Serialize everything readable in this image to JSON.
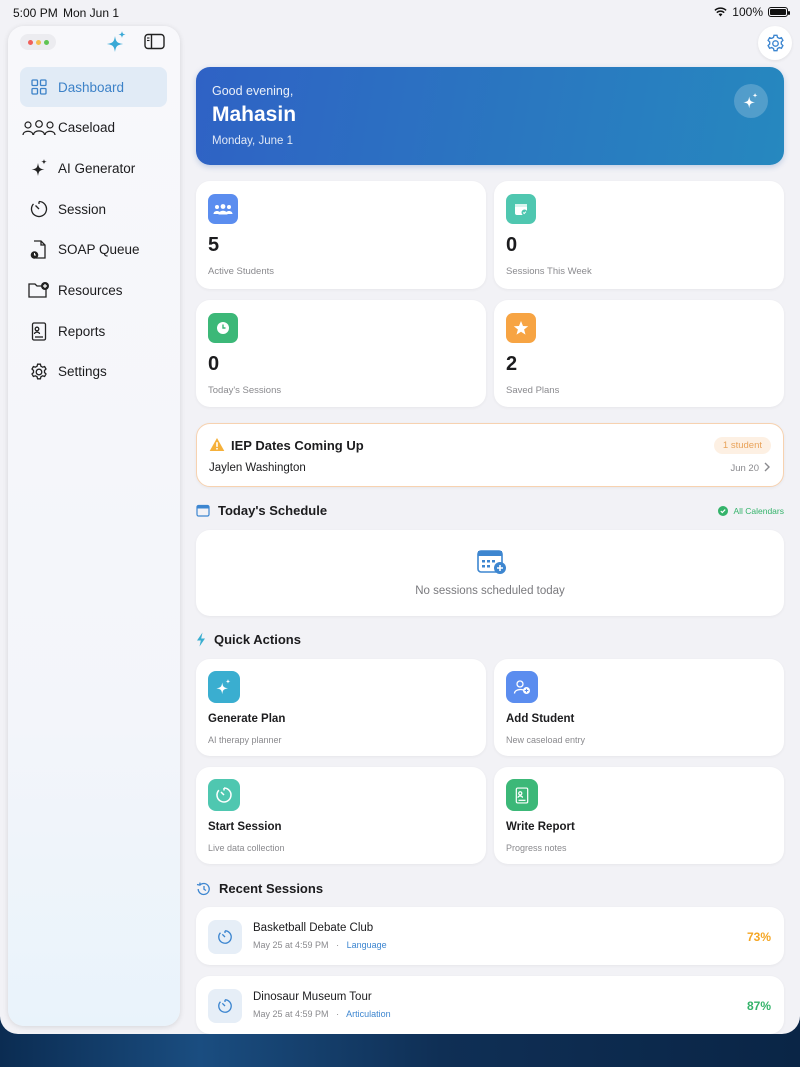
{
  "status_bar": {
    "time": "5:00 PM",
    "date": "Mon Jun 1",
    "battery": "100%"
  },
  "sidebar": {
    "items": [
      {
        "label": "Dashboard",
        "icon": "grid-icon",
        "active": true
      },
      {
        "label": "Caseload",
        "icon": "people-icon",
        "active": false
      },
      {
        "label": "AI Generator",
        "icon": "sparkles-icon",
        "active": false
      },
      {
        "label": "Session",
        "icon": "timer-icon",
        "active": false
      },
      {
        "label": "SOAP Queue",
        "icon": "document-clock-icon",
        "active": false
      },
      {
        "label": "Resources",
        "icon": "folder-add-icon",
        "active": false
      },
      {
        "label": "Reports",
        "icon": "report-icon",
        "active": false
      },
      {
        "label": "Settings",
        "icon": "gear-icon",
        "active": false
      }
    ]
  },
  "hero": {
    "greeting": "Good evening,",
    "name": "Mahasin",
    "date": "Monday, June 1"
  },
  "stats": [
    {
      "value": "5",
      "label": "Active Students",
      "color": "#5b8def",
      "icon": "people-icon"
    },
    {
      "value": "0",
      "label": "Sessions This Week",
      "color": "#4fc7b0",
      "icon": "calendar-check-icon"
    },
    {
      "value": "0",
      "label": "Today's Sessions",
      "color": "#3cb878",
      "icon": "clock-icon"
    },
    {
      "value": "2",
      "label": "Saved Plans",
      "color": "#f7a443",
      "icon": "star-icon"
    }
  ],
  "iep": {
    "title": "IEP Dates Coming Up",
    "pill": "1 student",
    "student": "Jaylen Washington",
    "date": "Jun 20"
  },
  "schedule": {
    "title": "Today's Schedule",
    "calendars": "All Calendars",
    "empty": "No sessions scheduled today"
  },
  "quick_actions": {
    "title": "Quick Actions",
    "items": [
      {
        "title": "Generate Plan",
        "subtitle": "AI therapy planner",
        "color": "#3aaed0",
        "icon": "sparkles-icon"
      },
      {
        "title": "Add Student",
        "subtitle": "New caseload entry",
        "color": "#5b8def",
        "icon": "person-add-icon"
      },
      {
        "title": "Start Session",
        "subtitle": "Live data collection",
        "color": "#4fc7b0",
        "icon": "timer-icon"
      },
      {
        "title": "Write Report",
        "subtitle": "Progress notes",
        "color": "#3cb878",
        "icon": "report-icon"
      }
    ]
  },
  "recent": {
    "title": "Recent Sessions",
    "items": [
      {
        "title": "Basketball Debate Club",
        "when": "May 25 at 4:59 PM",
        "sep": "·",
        "category": "Language",
        "percent": "73%",
        "color": "#f5a623"
      },
      {
        "title": "Dinosaur Museum Tour",
        "when": "May 25 at 4:59 PM",
        "sep": "·",
        "category": "Articulation",
        "percent": "87%",
        "color": "#34b36a"
      }
    ]
  }
}
